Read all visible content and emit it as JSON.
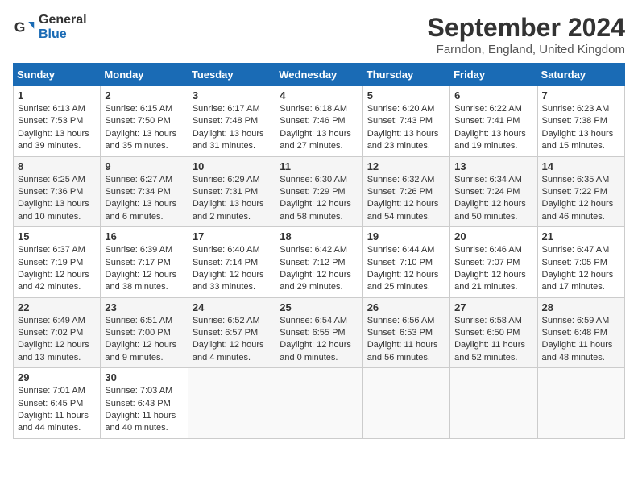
{
  "header": {
    "logo_line1": "General",
    "logo_line2": "Blue",
    "month_year": "September 2024",
    "location": "Farndon, England, United Kingdom"
  },
  "weekdays": [
    "Sunday",
    "Monday",
    "Tuesday",
    "Wednesday",
    "Thursday",
    "Friday",
    "Saturday"
  ],
  "weeks": [
    [
      {
        "day": "1",
        "sunrise": "6:13 AM",
        "sunset": "7:53 PM",
        "daylight": "13 hours and 39 minutes."
      },
      {
        "day": "2",
        "sunrise": "6:15 AM",
        "sunset": "7:50 PM",
        "daylight": "13 hours and 35 minutes."
      },
      {
        "day": "3",
        "sunrise": "6:17 AM",
        "sunset": "7:48 PM",
        "daylight": "13 hours and 31 minutes."
      },
      {
        "day": "4",
        "sunrise": "6:18 AM",
        "sunset": "7:46 PM",
        "daylight": "13 hours and 27 minutes."
      },
      {
        "day": "5",
        "sunrise": "6:20 AM",
        "sunset": "7:43 PM",
        "daylight": "13 hours and 23 minutes."
      },
      {
        "day": "6",
        "sunrise": "6:22 AM",
        "sunset": "7:41 PM",
        "daylight": "13 hours and 19 minutes."
      },
      {
        "day": "7",
        "sunrise": "6:23 AM",
        "sunset": "7:38 PM",
        "daylight": "13 hours and 15 minutes."
      }
    ],
    [
      {
        "day": "8",
        "sunrise": "6:25 AM",
        "sunset": "7:36 PM",
        "daylight": "13 hours and 10 minutes."
      },
      {
        "day": "9",
        "sunrise": "6:27 AM",
        "sunset": "7:34 PM",
        "daylight": "13 hours and 6 minutes."
      },
      {
        "day": "10",
        "sunrise": "6:29 AM",
        "sunset": "7:31 PM",
        "daylight": "13 hours and 2 minutes."
      },
      {
        "day": "11",
        "sunrise": "6:30 AM",
        "sunset": "7:29 PM",
        "daylight": "12 hours and 58 minutes."
      },
      {
        "day": "12",
        "sunrise": "6:32 AM",
        "sunset": "7:26 PM",
        "daylight": "12 hours and 54 minutes."
      },
      {
        "day": "13",
        "sunrise": "6:34 AM",
        "sunset": "7:24 PM",
        "daylight": "12 hours and 50 minutes."
      },
      {
        "day": "14",
        "sunrise": "6:35 AM",
        "sunset": "7:22 PM",
        "daylight": "12 hours and 46 minutes."
      }
    ],
    [
      {
        "day": "15",
        "sunrise": "6:37 AM",
        "sunset": "7:19 PM",
        "daylight": "12 hours and 42 minutes."
      },
      {
        "day": "16",
        "sunrise": "6:39 AM",
        "sunset": "7:17 PM",
        "daylight": "12 hours and 38 minutes."
      },
      {
        "day": "17",
        "sunrise": "6:40 AM",
        "sunset": "7:14 PM",
        "daylight": "12 hours and 33 minutes."
      },
      {
        "day": "18",
        "sunrise": "6:42 AM",
        "sunset": "7:12 PM",
        "daylight": "12 hours and 29 minutes."
      },
      {
        "day": "19",
        "sunrise": "6:44 AM",
        "sunset": "7:10 PM",
        "daylight": "12 hours and 25 minutes."
      },
      {
        "day": "20",
        "sunrise": "6:46 AM",
        "sunset": "7:07 PM",
        "daylight": "12 hours and 21 minutes."
      },
      {
        "day": "21",
        "sunrise": "6:47 AM",
        "sunset": "7:05 PM",
        "daylight": "12 hours and 17 minutes."
      }
    ],
    [
      {
        "day": "22",
        "sunrise": "6:49 AM",
        "sunset": "7:02 PM",
        "daylight": "12 hours and 13 minutes."
      },
      {
        "day": "23",
        "sunrise": "6:51 AM",
        "sunset": "7:00 PM",
        "daylight": "12 hours and 9 minutes."
      },
      {
        "day": "24",
        "sunrise": "6:52 AM",
        "sunset": "6:57 PM",
        "daylight": "12 hours and 4 minutes."
      },
      {
        "day": "25",
        "sunrise": "6:54 AM",
        "sunset": "6:55 PM",
        "daylight": "12 hours and 0 minutes."
      },
      {
        "day": "26",
        "sunrise": "6:56 AM",
        "sunset": "6:53 PM",
        "daylight": "11 hours and 56 minutes."
      },
      {
        "day": "27",
        "sunrise": "6:58 AM",
        "sunset": "6:50 PM",
        "daylight": "11 hours and 52 minutes."
      },
      {
        "day": "28",
        "sunrise": "6:59 AM",
        "sunset": "6:48 PM",
        "daylight": "11 hours and 48 minutes."
      }
    ],
    [
      {
        "day": "29",
        "sunrise": "7:01 AM",
        "sunset": "6:45 PM",
        "daylight": "11 hours and 44 minutes."
      },
      {
        "day": "30",
        "sunrise": "7:03 AM",
        "sunset": "6:43 PM",
        "daylight": "11 hours and 40 minutes."
      },
      null,
      null,
      null,
      null,
      null
    ]
  ]
}
